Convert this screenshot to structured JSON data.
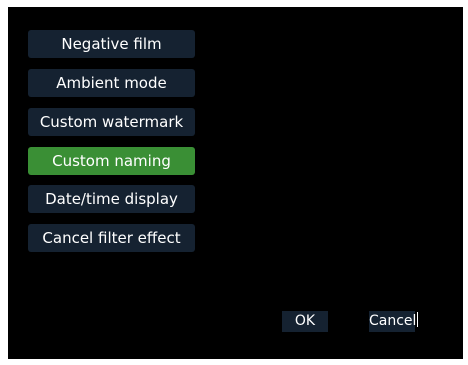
{
  "menu": {
    "items": [
      {
        "label": "Negative film"
      },
      {
        "label": "Ambient mode"
      },
      {
        "label": "Custom watermark"
      },
      {
        "label": "Custom naming",
        "selected": true
      },
      {
        "label": "Date/time display"
      },
      {
        "label": "Cancel filter effect"
      }
    ]
  },
  "dialog": {
    "ok_label": "OK",
    "cancel_label": "Cancel"
  },
  "colors": {
    "background": "#000000",
    "button": "#152231",
    "selected": "#3a8f35",
    "text": "#ffffff"
  }
}
